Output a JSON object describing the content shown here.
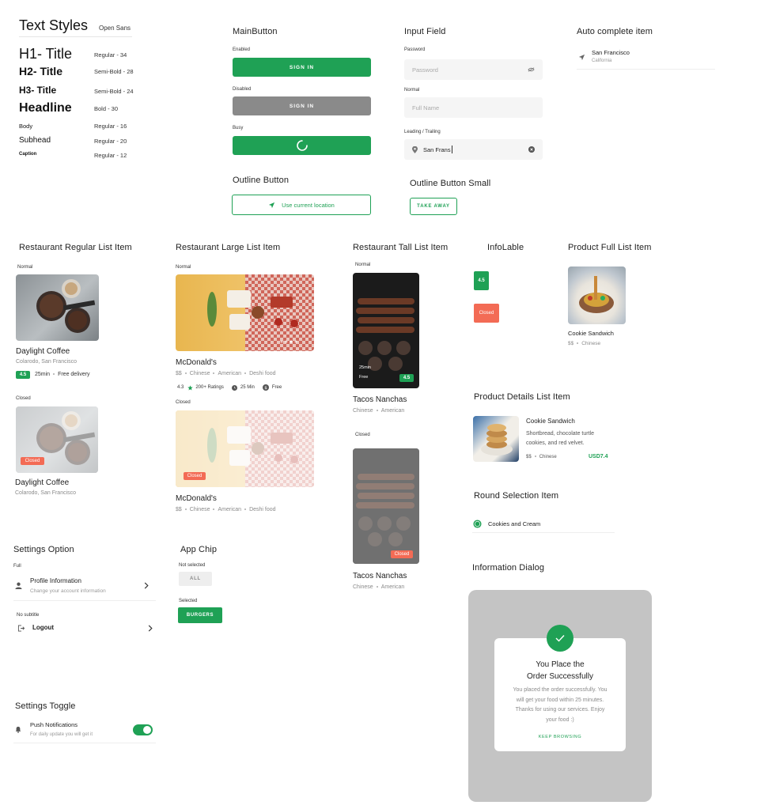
{
  "text_styles": {
    "title": "Text Styles",
    "font": "Open Sans",
    "rows": [
      {
        "sample": "H1- Title",
        "desc": "Regular - 34"
      },
      {
        "sample": "H2- Title",
        "desc": "Semi-Bold - 28"
      },
      {
        "sample": "H3- Title",
        "desc": "Semi-Bold - 24"
      },
      {
        "sample": "Headline",
        "desc": "Bold - 30"
      },
      {
        "sample": "Body",
        "desc": "Regular - 16"
      },
      {
        "sample": "Subhead",
        "desc": "Regular - 20"
      },
      {
        "sample": "Caption",
        "desc": "Regular - 12"
      }
    ]
  },
  "main_button": {
    "title": "MainButton",
    "enabled_label": "Enabled",
    "enabled_text": "SIGN IN",
    "disabled_label": "Disabled",
    "disabled_text": "SIGN IN",
    "busy_label": "Busy"
  },
  "outline_button": {
    "title": "Outline Button",
    "text": "Use current location"
  },
  "input_field": {
    "title": "Input Field",
    "password_label": "Password",
    "password_placeholder": "Password",
    "normal_label": "Normal",
    "normal_placeholder": "Full Name",
    "leading_label": "Leading / Trailing",
    "leading_value": "San Frans"
  },
  "outline_button_small": {
    "title": "Outline Button Small",
    "text": "TAKE AWAY"
  },
  "autocomplete": {
    "title": "Auto complete item",
    "main": "San Francisco",
    "sub": "California"
  },
  "regular_list": {
    "title": "Restaurant Regular List Item",
    "normal_label": "Normal",
    "closed_label": "Closed",
    "name": "Daylight Coffee",
    "location": "Colarodo, San Francisco",
    "rating": "4.5",
    "time": "25min",
    "delivery": "Free delivery",
    "closed_badge": "Closed"
  },
  "large_list": {
    "title": "Restaurant Large List Item",
    "normal_label": "Normal",
    "closed_label": "Closed",
    "name": "McDonald's",
    "tags": [
      "$$",
      "Chinese",
      "American",
      "Deshi food"
    ],
    "rating": "4.3",
    "ratings_count": "200+ Ratings",
    "time": "25 Min",
    "price": "Free",
    "closed_badge": "Closed"
  },
  "tall_list": {
    "title": "Restaurant Tall List Item",
    "normal_label": "Normal",
    "closed_label": "Closed",
    "name": "Tacos Nanchas",
    "tags": [
      "Chinese",
      "American"
    ],
    "time": "25min",
    "price": "Free",
    "rating": "4.5",
    "closed_badge": "Closed"
  },
  "info_label": {
    "title": "InfoLable",
    "rating": "4.5",
    "closed": "Closed"
  },
  "product_full": {
    "title": "Product Full List Item",
    "name": "Cookie Sandwich",
    "price": "$$",
    "cuisine": "Chinese"
  },
  "product_details": {
    "title": "Product Details List Item",
    "name": "Cookie Sandwich",
    "desc_line1": "Shortbread, chocolate turtle",
    "desc_line2": "cookies, and red velvet.",
    "price_tag": "$$",
    "cuisine": "Chinese",
    "price": "USD7.4"
  },
  "round_selection": {
    "title": "Round Selection Item",
    "label": "Cookies and Cream"
  },
  "settings_option": {
    "title": "Settings Option",
    "full_label": "Full",
    "profile_title": "Profile Information",
    "profile_sub": "Change your account information",
    "no_subtitle_label": "No subtitle",
    "logout": "Logout"
  },
  "app_chip": {
    "title": "App Chip",
    "not_selected_label": "Not selected",
    "not_selected_text": "ALL",
    "selected_label": "Selected",
    "selected_text": "BURGERS"
  },
  "settings_toggle": {
    "title": "Settings Toggle",
    "label": "Push Notifications",
    "sub": "For daily update you will get it"
  },
  "info_dialog": {
    "title": "Information Dialog",
    "heading_line1": "You Place the",
    "heading_line2": "Order Successfully",
    "body_line1": "You placed the order successfully. You",
    "body_line2": "will get your food within 25 minutes.",
    "body_line3": "Thanks for using our services. Enjoy",
    "body_line4": "your food :)",
    "action": "KEEP BROWSING"
  },
  "colors": {
    "primary": "#1fa155",
    "closed": "#f36b55",
    "disabled": "#8a8a8a"
  }
}
